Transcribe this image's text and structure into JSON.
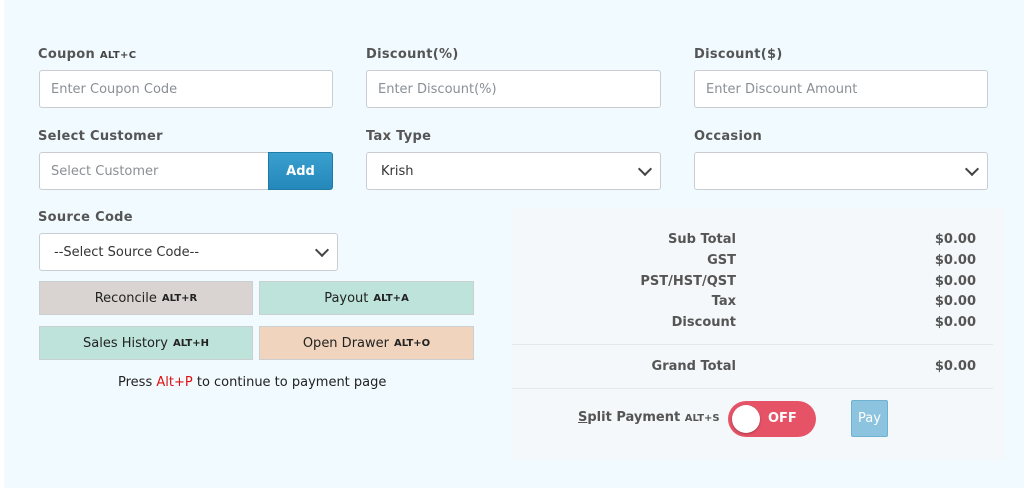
{
  "coupon": {
    "label": "Coupon",
    "shortcut": "ALT+C",
    "placeholder": "Enter Coupon Code"
  },
  "discount_pct": {
    "label": "Discount(%)",
    "placeholder": "Enter Discount(%)"
  },
  "discount_amt": {
    "label": "Discount($)",
    "placeholder": "Enter Discount Amount"
  },
  "customer": {
    "label": "Select Customer",
    "placeholder": "Select Customer",
    "add_label": "Add"
  },
  "tax_type": {
    "label": "Tax Type",
    "selected": "Krish"
  },
  "occasion": {
    "label": "Occasion",
    "selected": ""
  },
  "source_code": {
    "label": "Source Code",
    "selected": "--Select Source Code--"
  },
  "actions": {
    "reconcile": {
      "label": "Reconcile",
      "shortcut": "ALT+R",
      "color": "#d9d4d1"
    },
    "payout": {
      "label": "Payout",
      "shortcut": "ALT+A",
      "color": "#bde3da"
    },
    "sales_history": {
      "label": "Sales History",
      "shortcut": "ALT+H",
      "color": "#bde3da"
    },
    "open_drawer": {
      "label": "Open Drawer",
      "shortcut": "ALT+O",
      "color": "#f0d4bd"
    }
  },
  "hint": {
    "prefix": "Press",
    "key": "Alt+P",
    "suffix": "to continue to payment page"
  },
  "summary": {
    "sub_total": {
      "label": "Sub Total",
      "value": "$0.00"
    },
    "gst": {
      "label": "GST",
      "value": "$0.00"
    },
    "pst": {
      "label": "PST/HST/QST",
      "value": "$0.00"
    },
    "tax": {
      "label": "Tax",
      "value": "$0.00"
    },
    "discount": {
      "label": "Discount",
      "value": "$0.00"
    },
    "grand_total": {
      "label": "Grand Total",
      "value": "$0.00"
    }
  },
  "split_payment": {
    "label_first": "S",
    "label_rest": "plit Payment",
    "shortcut": "ALT+S",
    "toggle_text": "OFF",
    "on": false
  },
  "pay": {
    "label": "Pay"
  }
}
